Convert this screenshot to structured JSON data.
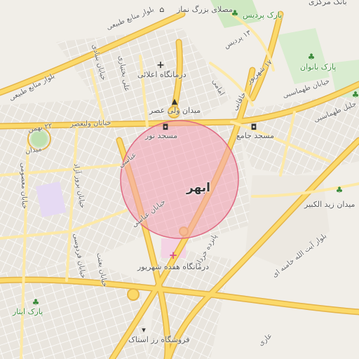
{
  "map": {
    "center_label": "ابهر",
    "colors": {
      "background": "#f1eee8",
      "major_road": "#fbd96a",
      "major_road_casing": "#e7b84a",
      "minor_road": "#ffffff",
      "park": "#cfe8c2",
      "hospital_area": "#f4d3e4",
      "highlight_fill": "#f4a3b4",
      "highlight_stroke": "#e06a83",
      "purple_area": "#e3d6f2"
    },
    "places": [
      {
        "id": "masalla",
        "label": "مصلای بزرگ نماز",
        "icon": "dome-icon"
      },
      {
        "id": "park_pardis",
        "label": "پارک پردیس",
        "icon": "tree-icon"
      },
      {
        "id": "bank_markazi",
        "label": "بانک مرکزی",
        "icon": "bank-icon"
      },
      {
        "id": "clinic_aalaei",
        "label": "درمانگاه اعلائی",
        "icon": "cross-icon"
      },
      {
        "id": "park_banovan",
        "label": "پارک بانوان",
        "icon": "tree-icon"
      },
      {
        "id": "meydan_valiasr",
        "label": "میدان ولی عصر",
        "icon": "monument-icon"
      },
      {
        "id": "masjed_nour",
        "label": "مسجد نور",
        "icon": "mosque-icon"
      },
      {
        "id": "masjed_jame",
        "label": "مسجد جامع",
        "icon": "mosque-icon"
      },
      {
        "id": "meydan_zeid",
        "label": "میدان زید الکبیر",
        "icon": "tree-icon"
      },
      {
        "id": "clinic_17shahrivar",
        "label": "درمانگاه هفده شهریور",
        "icon": "hospital-icon"
      },
      {
        "id": "park_isar",
        "label": "پارک ایثار",
        "icon": "tree-icon"
      },
      {
        "id": "store_rozastak",
        "label": "فروشگاه رز استاک",
        "icon": "cart-icon"
      }
    ],
    "roads": [
      {
        "id": "r1",
        "label": "بلوار منابع طبیعی"
      },
      {
        "id": "r2",
        "label": "بلوار منابع طبیعی"
      },
      {
        "id": "r3",
        "label": "خیابان ولیعصر"
      },
      {
        "id": "r4",
        "label": "خیابان عباسی"
      },
      {
        "id": "r5",
        "label": "بلوار آیت الله خامنه ای"
      },
      {
        "id": "r6",
        "label": "۱۷ شهریور"
      },
      {
        "id": "r7",
        "label": "خیابان طهماسبی"
      },
      {
        "id": "r8",
        "label": "خیابان جلیل طهماسبی"
      },
      {
        "id": "r9",
        "label": "خاقانی"
      },
      {
        "id": "r10",
        "label": "امامی"
      },
      {
        "id": "r11",
        "label": "۱۳ پردیس"
      },
      {
        "id": "r12",
        "label": "خیابان بنیادی"
      },
      {
        "id": "r13",
        "label": "علی بختیاری"
      },
      {
        "id": "r14",
        "label": "خیابان فردوسی"
      },
      {
        "id": "r15",
        "label": "خیابان بروز آزاد"
      },
      {
        "id": "r16",
        "label": "خیابان معصومی"
      },
      {
        "id": "r17",
        "label": "پانزده خرداد"
      },
      {
        "id": "r18",
        "label": "۲۲ بهمن"
      },
      {
        "id": "r19",
        "label": "میدان"
      },
      {
        "id": "r20",
        "label": "عباسی"
      },
      {
        "id": "r21",
        "label": "خیابان بعثت"
      },
      {
        "id": "r22",
        "label": "عاری"
      }
    ]
  }
}
